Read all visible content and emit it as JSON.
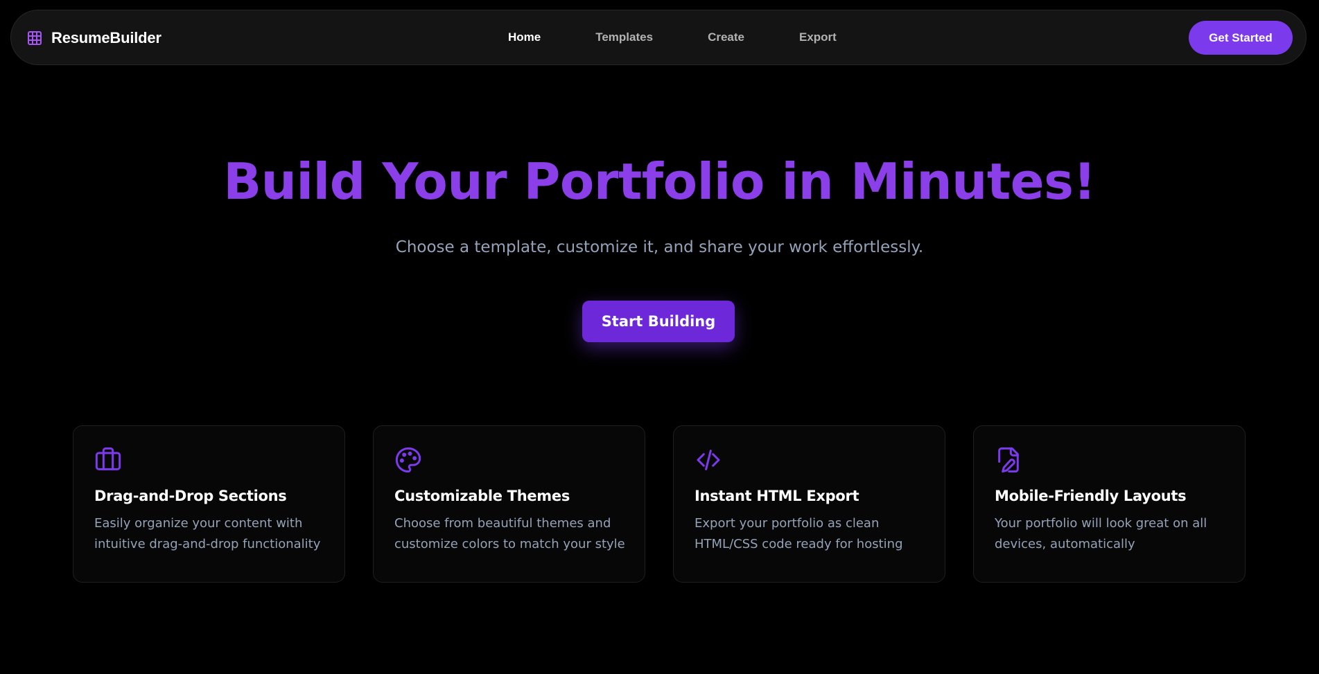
{
  "brand": {
    "name": "ResumeBuilder",
    "icon": "grid-icon"
  },
  "nav": {
    "links": [
      {
        "label": "Home",
        "active": true
      },
      {
        "label": "Templates",
        "active": false
      },
      {
        "label": "Create",
        "active": false
      },
      {
        "label": "Export",
        "active": false
      }
    ],
    "cta_label": "Get Started"
  },
  "hero": {
    "title": "Build Your Portfolio in Minutes!",
    "subtitle": "Choose a template, customize it, and share your work effortlessly.",
    "cta_label": "Start Building"
  },
  "features": [
    {
      "icon": "briefcase-icon",
      "title": "Drag-and-Drop Sections",
      "description": "Easily organize your content with intuitive drag-and-drop functionality"
    },
    {
      "icon": "palette-icon",
      "title": "Customizable Themes",
      "description": "Choose from beautiful themes and customize colors to match your style"
    },
    {
      "icon": "code-icon",
      "title": "Instant HTML Export",
      "description": "Export your portfolio as clean HTML/CSS code ready for hosting"
    },
    {
      "icon": "file-pen-icon",
      "title": "Mobile-Friendly Layouts",
      "description": "Your portfolio will look great on all devices, automatically"
    }
  ],
  "colors": {
    "accent": "#7c3aed",
    "background": "#000000",
    "muted_text": "#94a3b8"
  }
}
